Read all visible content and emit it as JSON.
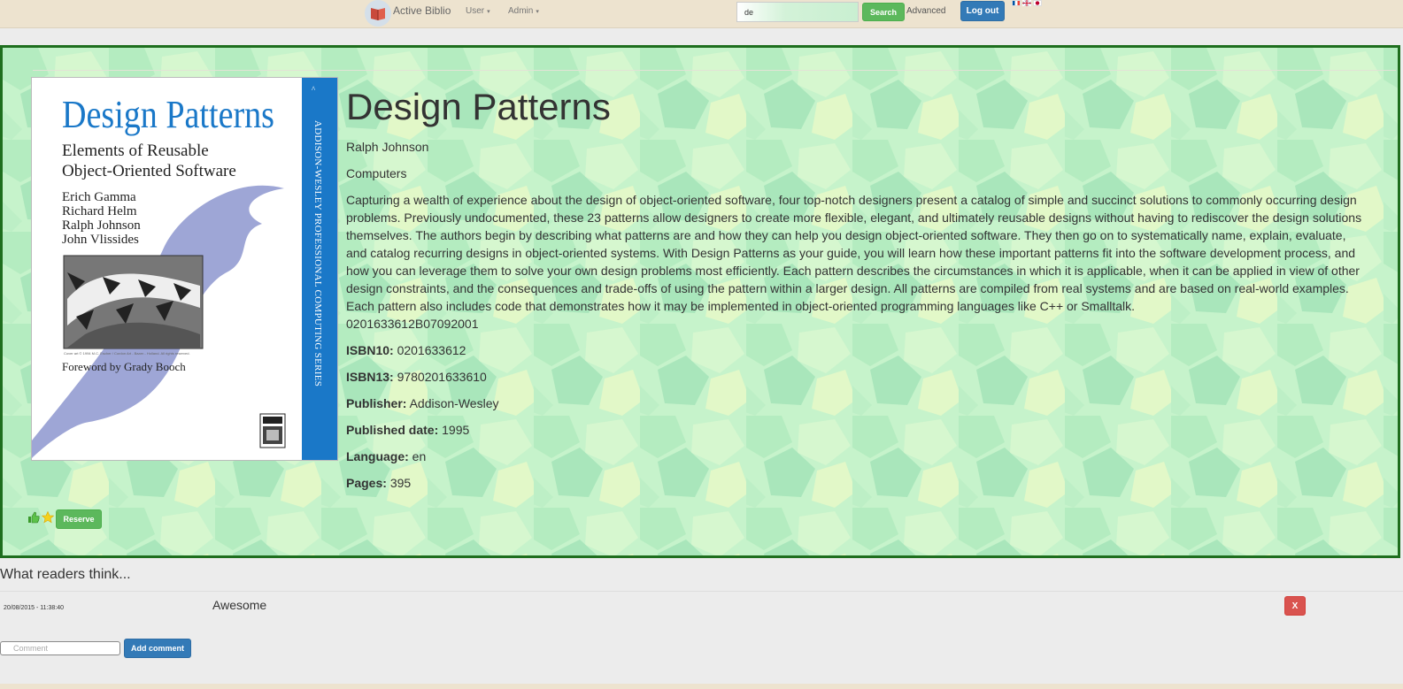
{
  "navbar": {
    "brand": "Active Biblio",
    "menu_user": "User",
    "menu_admin": "Admin",
    "search_value": "de",
    "search_button": "Search",
    "advanced_link": "Advanced",
    "logout_button": "Log out",
    "flags": [
      "fr-flag-icon",
      "uk-flag-icon",
      "jp-flag-icon"
    ]
  },
  "book": {
    "title": "Design Patterns",
    "author": "Ralph Johnson",
    "category": "Computers",
    "description": "Capturing a wealth of experience about the design of object-oriented software, four top-notch designers present a catalog of simple and succinct solutions to commonly occurring design problems. Previously undocumented, these 23 patterns allow designers to create more flexible, elegant, and ultimately reusable designs without having to rediscover the design solutions themselves. The authors begin by describing what patterns are and how they can help you design object-oriented software. They then go on to systematically name, explain, evaluate, and catalog recurring designs in object-oriented systems. With Design Patterns as your guide, you will learn how these important patterns fit into the software development process, and how you can leverage them to solve your own design problems most efficiently. Each pattern describes the circumstances in which it is applicable, when it can be applied in view of other design constraints, and the consequences and trade-offs of using the pattern within a larger design. All patterns are compiled from real systems and are based on real-world examples. Each pattern also includes code that demonstrates how it may be implemented in object-oriented programming languages like C++ or Smalltalk.",
    "reference": "0201633612B07092001",
    "isbn10_label": "ISBN10:",
    "isbn10": "0201633612",
    "isbn13_label": "ISBN13:",
    "isbn13": "9780201633610",
    "publisher_label": "Publisher:",
    "publisher": "Addison-Wesley",
    "published_date_label": "Published date:",
    "published_date": "1995",
    "language_label": "Language:",
    "language": "en",
    "pages_label": "Pages:",
    "pages": "395",
    "reserve_button": "Reserve",
    "cover": {
      "title": "Design Patterns",
      "subtitle_line1": "Elements of Reusable",
      "subtitle_line2": "Object-Oriented Software",
      "authors": [
        "Erich Gamma",
        "Richard Helm",
        "Ralph Johnson",
        "John Vlissides"
      ],
      "foreword": "Foreword by Grady Booch",
      "spine": "ADDISON-WESLEY PROFESSIONAL COMPUTING SERIES"
    }
  },
  "reviews": {
    "title": "What readers think...",
    "items": [
      {
        "date": "20/08/2015 - 11:38:40",
        "text": "Awesome",
        "delete_label": "X"
      }
    ],
    "comment_placeholder": "Comment",
    "add_comment_button": "Add comment"
  },
  "colors": {
    "navbar_bg": "#ede3cf",
    "panel_border": "#1e6e1e",
    "panel_bg": "#c7f5cc",
    "cover_blue": "#1a78c8",
    "brand_red": "#c94a3c"
  }
}
